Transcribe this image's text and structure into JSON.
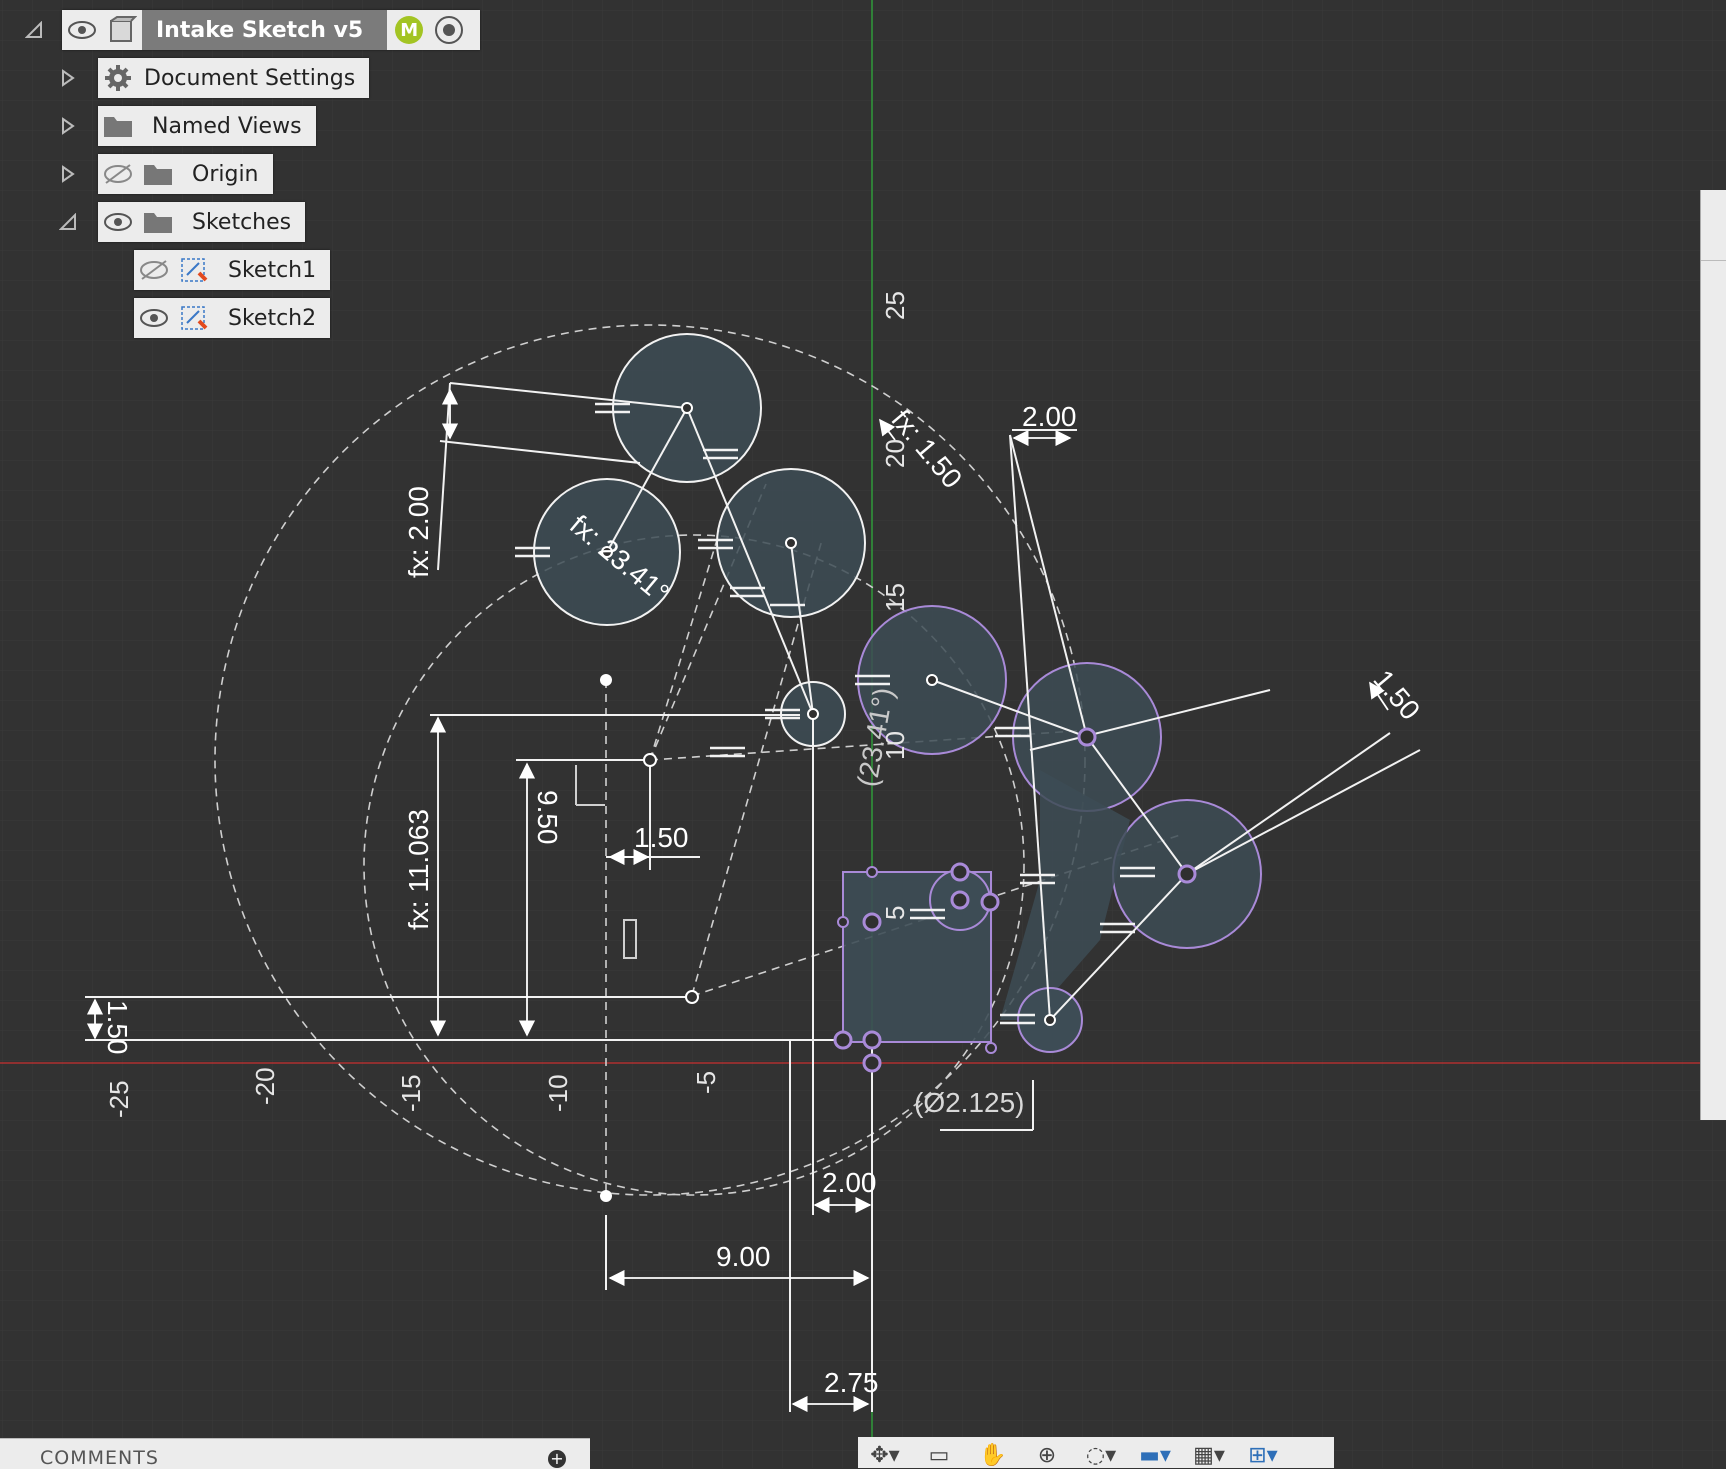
{
  "browser": {
    "root": {
      "name": "Intake Sketch v5",
      "badge": "M"
    },
    "items": [
      {
        "label": "Document Settings"
      },
      {
        "label": "Named Views"
      },
      {
        "label": "Origin"
      },
      {
        "label": "Sketches"
      },
      {
        "label": "Sketch1"
      },
      {
        "label": "Sketch2"
      }
    ]
  },
  "axis": {
    "x_ticks": [
      "-25",
      "-20",
      "-15",
      "-10",
      "-5"
    ],
    "y_ticks": [
      "25",
      "20",
      "15",
      "10",
      "5"
    ]
  },
  "dimensions": {
    "d1": "2.00",
    "d2": "fx: 1.50",
    "d3": "fx: 2.00",
    "d4": "fx: 23.41°",
    "d5": "1.50",
    "d6": "(23.41°)",
    "d7": "fx: 11.063",
    "d8": "9.50",
    "d9": "1.50",
    "d10": "1.50",
    "d11": "(Ø2.125)",
    "d12": "2.00",
    "d13": "9.00",
    "d14": "2.75"
  },
  "comments": {
    "label": "COMMENTS"
  },
  "colors": {
    "background": "#323232",
    "grid": "#3c3c3c",
    "x_axis": "#b03030",
    "y_axis": "#2f9a3a",
    "sketch_fill": "#3d4c55",
    "selected": "#a98ad8"
  }
}
